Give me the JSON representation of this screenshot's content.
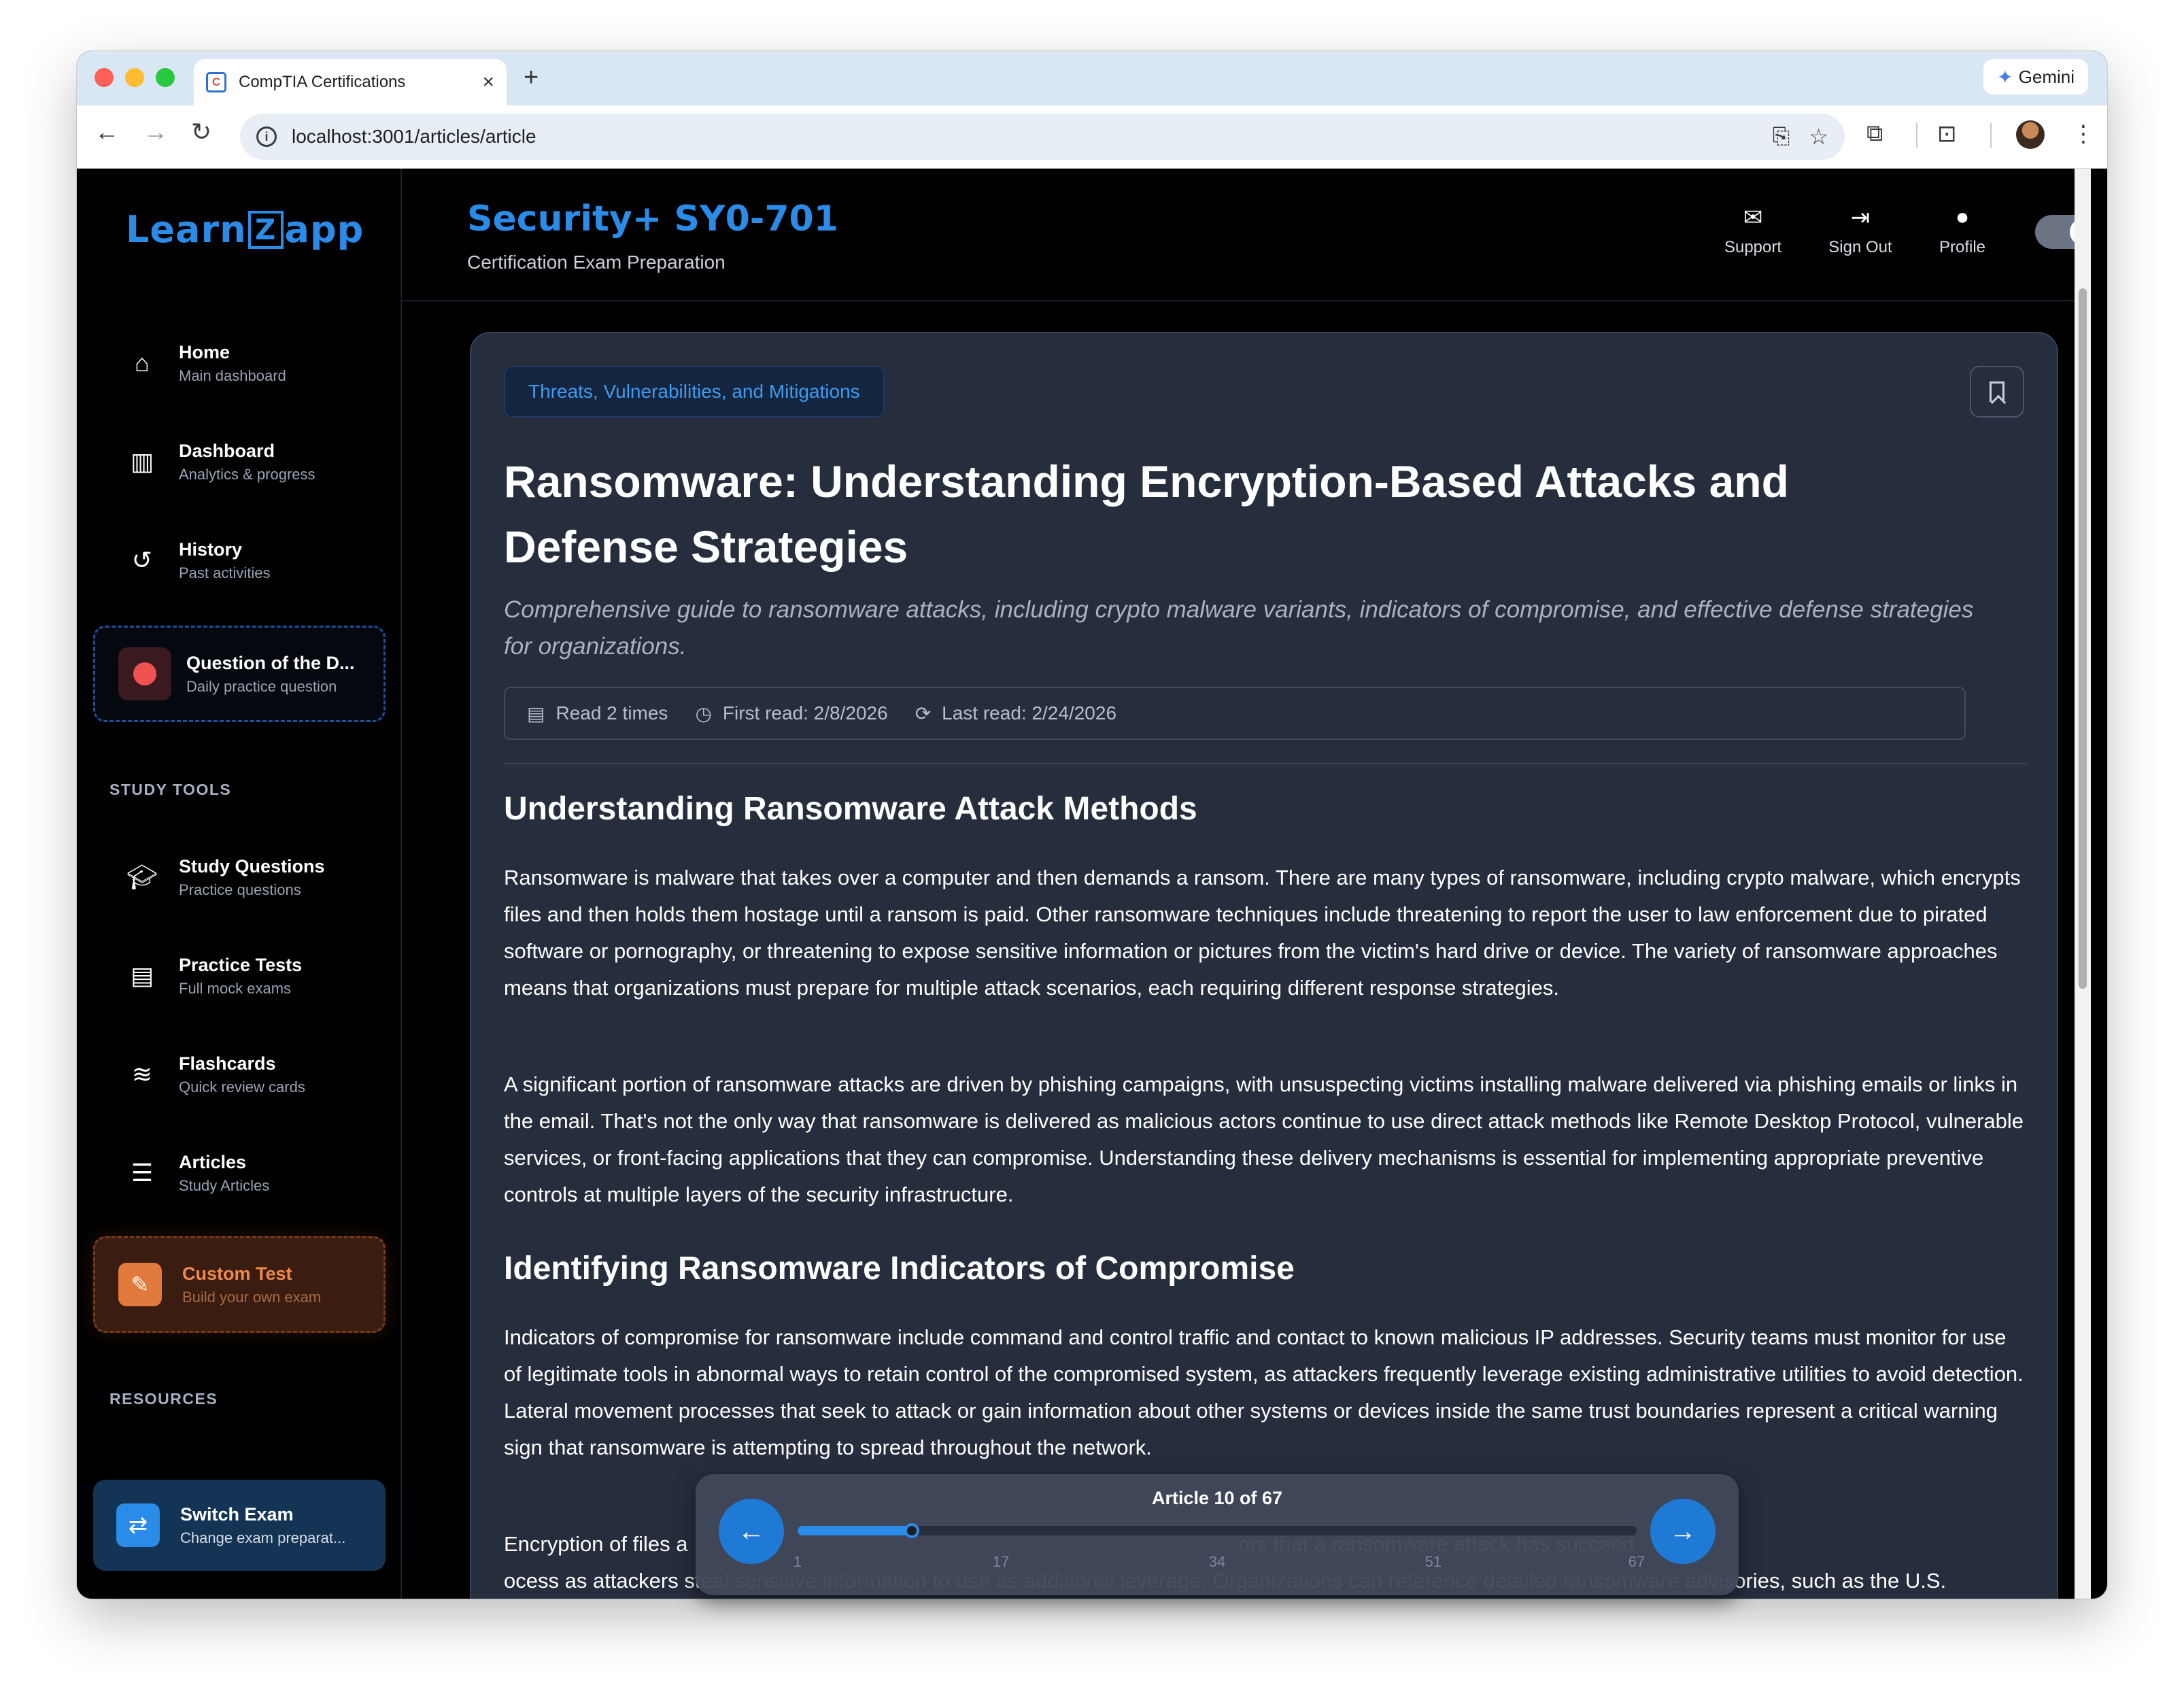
{
  "browser": {
    "tab_title": "CompTIA Certifications",
    "url": "localhost:3001/articles/article",
    "gemini_label": "Gemini"
  },
  "sidebar": {
    "logo_pre": "Learn",
    "logo_z": "Z",
    "logo_post": "app",
    "items": [
      {
        "label": "Home",
        "sub": "Main dashboard",
        "icon": "home-icon"
      },
      {
        "label": "Dashboard",
        "sub": "Analytics & progress",
        "icon": "bar-chart-icon"
      },
      {
        "label": "History",
        "sub": "Past activities",
        "icon": "history-icon"
      }
    ],
    "qotd": {
      "label": "Question of the D...",
      "sub": "Daily practice question"
    },
    "study_tools_heading": "STUDY TOOLS",
    "study_tools": [
      {
        "label": "Study Questions",
        "sub": "Practice questions",
        "icon": "graduation-cap-icon"
      },
      {
        "label": "Practice Tests",
        "sub": "Full mock exams",
        "icon": "clipboard-icon"
      },
      {
        "label": "Flashcards",
        "sub": "Quick review cards",
        "icon": "layers-icon"
      },
      {
        "label": "Articles",
        "sub": "Study Articles",
        "icon": "newspaper-icon"
      }
    ],
    "custom_test": {
      "label": "Custom Test",
      "sub": "Build your own exam"
    },
    "resources_heading": "RESOURCES",
    "switch_exam": {
      "label": "Switch Exam",
      "sub": "Change exam preparat..."
    }
  },
  "header": {
    "exam_title": "Security+ SY0-701",
    "exam_sub": "Certification Exam Preparation",
    "support": "Support",
    "sign_out": "Sign Out",
    "profile": "Profile"
  },
  "article": {
    "topic": "Threats, Vulnerabilities, and Mitigations",
    "title": "Ransomware: Understanding Encryption-Based Attacks and Defense Strategies",
    "subtitle": "Comprehensive guide to ransomware attacks, including crypto malware variants, indicators of compromise, and effective defense strategies for organizations.",
    "stats": {
      "read_count": "Read 2 times",
      "first_read": "First read: 2/8/2026",
      "last_read": "Last read: 2/24/2026"
    },
    "section1_heading": "Understanding Ransomware Attack Methods",
    "section1_p1": "Ransomware is malware that takes over a computer and then demands a ransom. There are many types of ransomware, including crypto malware, which encrypts files and then holds them hostage until a ransom is paid. Other ransomware techniques include threatening to report the user to law enforcement due to pirated software or pornography, or threatening to expose sensitive information or pictures from the victim's hard drive or device. The variety of ransomware approaches means that organizations must prepare for multiple attack scenarios, each requiring different response strategies.",
    "section1_p2": "A significant portion of ransomware attacks are driven by phishing campaigns, with unsuspecting victims installing malware delivered via phishing emails or links in the email. That's not the only way that ransomware is delivered as malicious actors continue to use direct attack methods like Remote Desktop Protocol, vulnerable services, or front-facing applications that they can compromise. Understanding these delivery mechanisms is essential for implementing appropriate preventive controls at multiple layers of the security infrastructure.",
    "section2_heading": "Identifying Ransomware Indicators of Compromise",
    "section2_p1": "Indicators of compromise for ransomware include command and control traffic and contact to known malicious IP addresses. Security teams must monitor for use of legitimate tools in abnormal ways to retain control of the compromised system, as attackers frequently leverage existing administrative utilities to avoid detection. Lateral movement processes that seek to attack or gain information about other systems or devices inside the same trust boundaries represent a critical warning sign that ransomware is attempting to spread throughout the network.",
    "section2_p2": "Encryption of files a                                                                                              ors that a ransomware attack has succeed                                                                                              ocess as attackers steal sensitive information to use as additional leverage. Organizations can reference detailed ransomware advisories, such as the U.S. Cybersecurity &"
  },
  "pager": {
    "label": "Article 10 of 67",
    "current": 10,
    "total": 67,
    "ticks": [
      "1",
      "17",
      "34",
      "51",
      "67"
    ]
  },
  "colors": {
    "accent": "#2b8be8",
    "card_bg": "#262d3d",
    "custom_test_accent": "#e0793b",
    "qotd_dot": "#f05252"
  }
}
